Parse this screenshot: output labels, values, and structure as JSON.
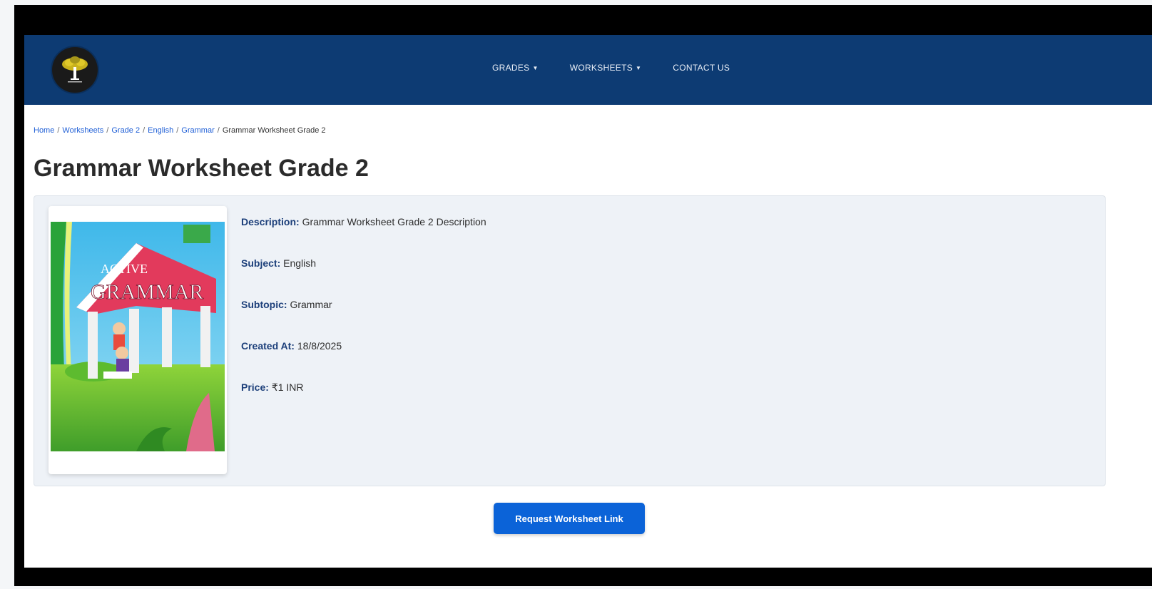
{
  "nav": {
    "items": [
      {
        "label": "GRADES",
        "dropdown": true
      },
      {
        "label": "WORKSHEETS",
        "dropdown": true
      },
      {
        "label": "CONTACT US",
        "dropdown": false
      }
    ]
  },
  "breadcrumb": {
    "links": [
      "Home",
      "Worksheets",
      "Grade 2",
      "English",
      "Grammar"
    ],
    "current": "Grammar Worksheet Grade 2"
  },
  "page": {
    "title": "Grammar Worksheet Grade 2"
  },
  "details": [
    {
      "key": "Description:",
      "value": "Grammar Worksheet Grade 2 Description"
    },
    {
      "key": "Subject:",
      "value": "English"
    },
    {
      "key": "Subtopic:",
      "value": "Grammar"
    },
    {
      "key": "Created At:",
      "value": "18/8/2025"
    },
    {
      "key": "Price:",
      "value": "₹1 INR"
    }
  ],
  "cover": {
    "word1": "ACTIVE",
    "word2": "GRAMMAR"
  },
  "cta": {
    "label": "Request Worksheet Link"
  },
  "colors": {
    "navbar": "#0d3b73",
    "button": "#0b63d8",
    "link": "#1f5fd6"
  }
}
